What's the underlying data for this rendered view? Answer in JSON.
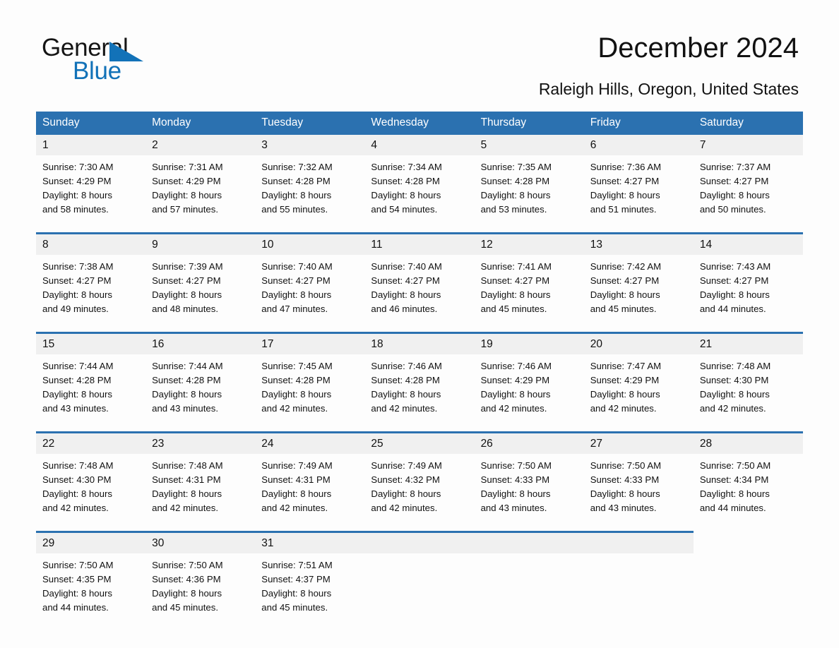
{
  "brand": {
    "name_part1": "General",
    "name_part2": "Blue",
    "accent_color": "#1272b8"
  },
  "header": {
    "title": "December 2024",
    "subtitle": "Raleigh Hills, Oregon, United States"
  },
  "theme": {
    "header_blue": "#2b71b0",
    "date_row_gray": "#f0f0f0",
    "page_background": "#fdfdfd"
  },
  "calendar": {
    "weekday_headers": [
      "Sunday",
      "Monday",
      "Tuesday",
      "Wednesday",
      "Thursday",
      "Friday",
      "Saturday"
    ],
    "weeks": [
      {
        "days": [
          {
            "date": "1",
            "sunrise": "Sunrise: 7:30 AM",
            "sunset": "Sunset: 4:29 PM",
            "daylight_1": "Daylight: 8 hours",
            "daylight_2": "and 58 minutes."
          },
          {
            "date": "2",
            "sunrise": "Sunrise: 7:31 AM",
            "sunset": "Sunset: 4:29 PM",
            "daylight_1": "Daylight: 8 hours",
            "daylight_2": "and 57 minutes."
          },
          {
            "date": "3",
            "sunrise": "Sunrise: 7:32 AM",
            "sunset": "Sunset: 4:28 PM",
            "daylight_1": "Daylight: 8 hours",
            "daylight_2": "and 55 minutes."
          },
          {
            "date": "4",
            "sunrise": "Sunrise: 7:34 AM",
            "sunset": "Sunset: 4:28 PM",
            "daylight_1": "Daylight: 8 hours",
            "daylight_2": "and 54 minutes."
          },
          {
            "date": "5",
            "sunrise": "Sunrise: 7:35 AM",
            "sunset": "Sunset: 4:28 PM",
            "daylight_1": "Daylight: 8 hours",
            "daylight_2": "and 53 minutes."
          },
          {
            "date": "6",
            "sunrise": "Sunrise: 7:36 AM",
            "sunset": "Sunset: 4:27 PM",
            "daylight_1": "Daylight: 8 hours",
            "daylight_2": "and 51 minutes."
          },
          {
            "date": "7",
            "sunrise": "Sunrise: 7:37 AM",
            "sunset": "Sunset: 4:27 PM",
            "daylight_1": "Daylight: 8 hours",
            "daylight_2": "and 50 minutes."
          }
        ]
      },
      {
        "days": [
          {
            "date": "8",
            "sunrise": "Sunrise: 7:38 AM",
            "sunset": "Sunset: 4:27 PM",
            "daylight_1": "Daylight: 8 hours",
            "daylight_2": "and 49 minutes."
          },
          {
            "date": "9",
            "sunrise": "Sunrise: 7:39 AM",
            "sunset": "Sunset: 4:27 PM",
            "daylight_1": "Daylight: 8 hours",
            "daylight_2": "and 48 minutes."
          },
          {
            "date": "10",
            "sunrise": "Sunrise: 7:40 AM",
            "sunset": "Sunset: 4:27 PM",
            "daylight_1": "Daylight: 8 hours",
            "daylight_2": "and 47 minutes."
          },
          {
            "date": "11",
            "sunrise": "Sunrise: 7:40 AM",
            "sunset": "Sunset: 4:27 PM",
            "daylight_1": "Daylight: 8 hours",
            "daylight_2": "and 46 minutes."
          },
          {
            "date": "12",
            "sunrise": "Sunrise: 7:41 AM",
            "sunset": "Sunset: 4:27 PM",
            "daylight_1": "Daylight: 8 hours",
            "daylight_2": "and 45 minutes."
          },
          {
            "date": "13",
            "sunrise": "Sunrise: 7:42 AM",
            "sunset": "Sunset: 4:27 PM",
            "daylight_1": "Daylight: 8 hours",
            "daylight_2": "and 45 minutes."
          },
          {
            "date": "14",
            "sunrise": "Sunrise: 7:43 AM",
            "sunset": "Sunset: 4:27 PM",
            "daylight_1": "Daylight: 8 hours",
            "daylight_2": "and 44 minutes."
          }
        ]
      },
      {
        "days": [
          {
            "date": "15",
            "sunrise": "Sunrise: 7:44 AM",
            "sunset": "Sunset: 4:28 PM",
            "daylight_1": "Daylight: 8 hours",
            "daylight_2": "and 43 minutes."
          },
          {
            "date": "16",
            "sunrise": "Sunrise: 7:44 AM",
            "sunset": "Sunset: 4:28 PM",
            "daylight_1": "Daylight: 8 hours",
            "daylight_2": "and 43 minutes."
          },
          {
            "date": "17",
            "sunrise": "Sunrise: 7:45 AM",
            "sunset": "Sunset: 4:28 PM",
            "daylight_1": "Daylight: 8 hours",
            "daylight_2": "and 42 minutes."
          },
          {
            "date": "18",
            "sunrise": "Sunrise: 7:46 AM",
            "sunset": "Sunset: 4:28 PM",
            "daylight_1": "Daylight: 8 hours",
            "daylight_2": "and 42 minutes."
          },
          {
            "date": "19",
            "sunrise": "Sunrise: 7:46 AM",
            "sunset": "Sunset: 4:29 PM",
            "daylight_1": "Daylight: 8 hours",
            "daylight_2": "and 42 minutes."
          },
          {
            "date": "20",
            "sunrise": "Sunrise: 7:47 AM",
            "sunset": "Sunset: 4:29 PM",
            "daylight_1": "Daylight: 8 hours",
            "daylight_2": "and 42 minutes."
          },
          {
            "date": "21",
            "sunrise": "Sunrise: 7:48 AM",
            "sunset": "Sunset: 4:30 PM",
            "daylight_1": "Daylight: 8 hours",
            "daylight_2": "and 42 minutes."
          }
        ]
      },
      {
        "days": [
          {
            "date": "22",
            "sunrise": "Sunrise: 7:48 AM",
            "sunset": "Sunset: 4:30 PM",
            "daylight_1": "Daylight: 8 hours",
            "daylight_2": "and 42 minutes."
          },
          {
            "date": "23",
            "sunrise": "Sunrise: 7:48 AM",
            "sunset": "Sunset: 4:31 PM",
            "daylight_1": "Daylight: 8 hours",
            "daylight_2": "and 42 minutes."
          },
          {
            "date": "24",
            "sunrise": "Sunrise: 7:49 AM",
            "sunset": "Sunset: 4:31 PM",
            "daylight_1": "Daylight: 8 hours",
            "daylight_2": "and 42 minutes."
          },
          {
            "date": "25",
            "sunrise": "Sunrise: 7:49 AM",
            "sunset": "Sunset: 4:32 PM",
            "daylight_1": "Daylight: 8 hours",
            "daylight_2": "and 42 minutes."
          },
          {
            "date": "26",
            "sunrise": "Sunrise: 7:50 AM",
            "sunset": "Sunset: 4:33 PM",
            "daylight_1": "Daylight: 8 hours",
            "daylight_2": "and 43 minutes."
          },
          {
            "date": "27",
            "sunrise": "Sunrise: 7:50 AM",
            "sunset": "Sunset: 4:33 PM",
            "daylight_1": "Daylight: 8 hours",
            "daylight_2": "and 43 minutes."
          },
          {
            "date": "28",
            "sunrise": "Sunrise: 7:50 AM",
            "sunset": "Sunset: 4:34 PM",
            "daylight_1": "Daylight: 8 hours",
            "daylight_2": "and 44 minutes."
          }
        ]
      },
      {
        "days": [
          {
            "date": "29",
            "sunrise": "Sunrise: 7:50 AM",
            "sunset": "Sunset: 4:35 PM",
            "daylight_1": "Daylight: 8 hours",
            "daylight_2": "and 44 minutes."
          },
          {
            "date": "30",
            "sunrise": "Sunrise: 7:50 AM",
            "sunset": "Sunset: 4:36 PM",
            "daylight_1": "Daylight: 8 hours",
            "daylight_2": "and 45 minutes."
          },
          {
            "date": "31",
            "sunrise": "Sunrise: 7:51 AM",
            "sunset": "Sunset: 4:37 PM",
            "daylight_1": "Daylight: 8 hours",
            "daylight_2": "and 45 minutes."
          },
          {
            "date": "",
            "sunrise": "",
            "sunset": "",
            "daylight_1": "",
            "daylight_2": ""
          },
          {
            "date": "",
            "sunrise": "",
            "sunset": "",
            "daylight_1": "",
            "daylight_2": ""
          },
          {
            "date": "",
            "sunrise": "",
            "sunset": "",
            "daylight_1": "",
            "daylight_2": ""
          },
          {
            "date": "",
            "sunrise": "",
            "sunset": "",
            "daylight_1": "",
            "daylight_2": ""
          }
        ]
      }
    ]
  }
}
